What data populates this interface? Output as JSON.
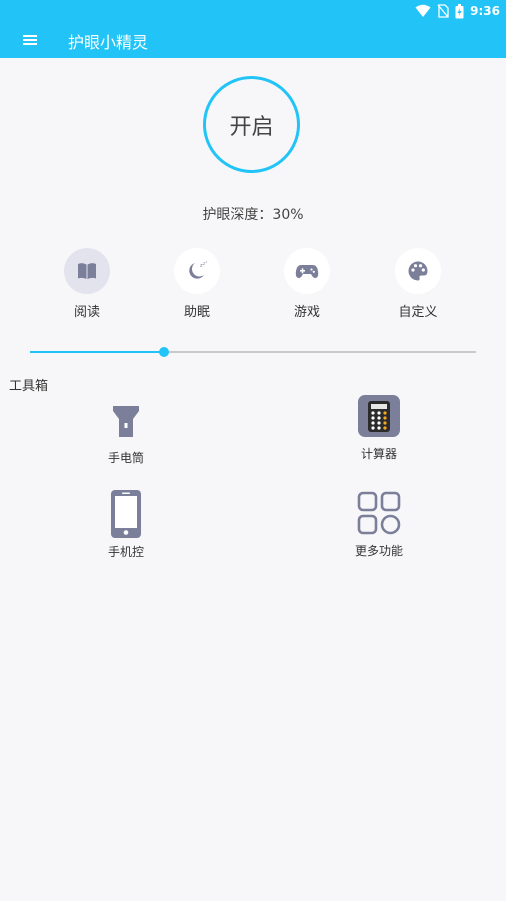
{
  "status": {
    "time": "9:36"
  },
  "appbar": {
    "title": "护眼小精灵"
  },
  "power": {
    "label": "开启"
  },
  "depth": {
    "text": "护眼深度：30%",
    "value": 0.3
  },
  "modes": [
    {
      "label": "阅读",
      "icon": "book-icon",
      "active": true
    },
    {
      "label": "助眠",
      "icon": "moon-sleep-icon",
      "active": false
    },
    {
      "label": "游戏",
      "icon": "gamepad-icon",
      "active": false
    },
    {
      "label": "自定义",
      "icon": "palette-icon",
      "active": false
    }
  ],
  "toolbox": {
    "title": "工具箱",
    "tools": [
      {
        "label": "手电筒",
        "icon": "flashlight-icon"
      },
      {
        "label": "计算器",
        "icon": "calculator-icon"
      },
      {
        "label": "手机控",
        "icon": "phone-icon"
      },
      {
        "label": "更多功能",
        "icon": "more-grid-icon"
      }
    ]
  },
  "colors": {
    "accent": "#22c4f7",
    "icon": "#7c7f9a",
    "active_bg": "#e3e3ee"
  }
}
